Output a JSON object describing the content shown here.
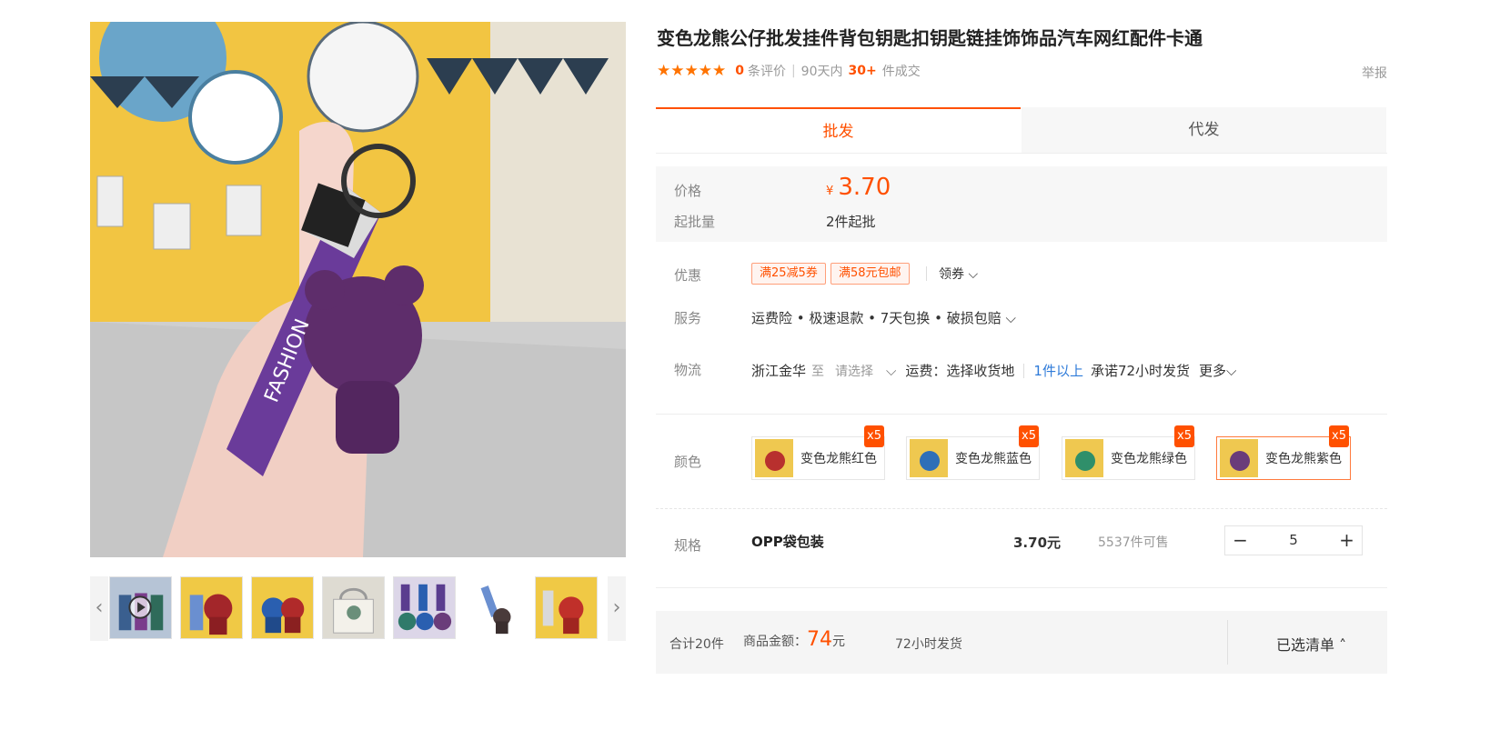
{
  "gallery": {
    "prev_icon": "chevron-left-icon",
    "next_icon": "chevron-right-icon",
    "thumbnails": [
      "video-thumb",
      "red-bear",
      "blue-bear",
      "tote-bag",
      "three-bears",
      "single-charm",
      "red-charm"
    ],
    "main_image_text": "FASHION"
  },
  "product": {
    "title": "变色龙熊公仔批发挂件背包钥匙扣钥匙链挂饰饰品汽车网红配件卡通",
    "stars": "★★★★★",
    "review_count": "0",
    "review_label": "条评价",
    "sales_period": "90天内",
    "sales_count": "30+",
    "sales_label": "件成交",
    "report": "举报"
  },
  "tabs": {
    "wholesale": "批发",
    "dropship": "代发"
  },
  "pricing": {
    "price_label": "价格",
    "currency": "¥",
    "price": "3.70",
    "moq_label": "起批量",
    "moq_value": "2件起批"
  },
  "promotions": {
    "label": "优惠",
    "coupons": [
      "满25减5券",
      "满58元包邮"
    ],
    "claim_label": "领券 ⌵"
  },
  "services": {
    "label": "服务",
    "items": "运费险 • 极速退款 • 7天包换 • 破损包赔 ⌵"
  },
  "logistics": {
    "label": "物流",
    "origin": "浙江金华",
    "to": "至",
    "select": "请选择",
    "select_arrow": "⌵",
    "shipping": "运费：选择收货地",
    "qty_threshold": "1件以上",
    "promise": "承诺72小时发货",
    "more": "更多⌵"
  },
  "colors": {
    "label": "颜色",
    "options": [
      {
        "name": "变色龙熊红色",
        "badge": "x5",
        "swatch": "#b8302e"
      },
      {
        "name": "变色龙熊蓝色",
        "badge": "x5",
        "swatch": "#2e6fb8"
      },
      {
        "name": "变色龙熊绿色",
        "badge": "x5",
        "swatch": "#2f8f6a"
      },
      {
        "name": "变色龙熊紫色",
        "badge": "x5",
        "swatch": "#6a3c7a"
      }
    ]
  },
  "spec": {
    "label": "规格",
    "name": "OPP袋包装",
    "price": "3.70元",
    "stock": "5537件可售",
    "minus": "−",
    "plus": "+",
    "quantity": "5"
  },
  "footer": {
    "total_count": "合计20件",
    "amount_label": "商品金额：",
    "amount": "74",
    "amount_unit": "元",
    "ship_time": "72小时发货",
    "selected_list": "已选清单 ˄"
  }
}
